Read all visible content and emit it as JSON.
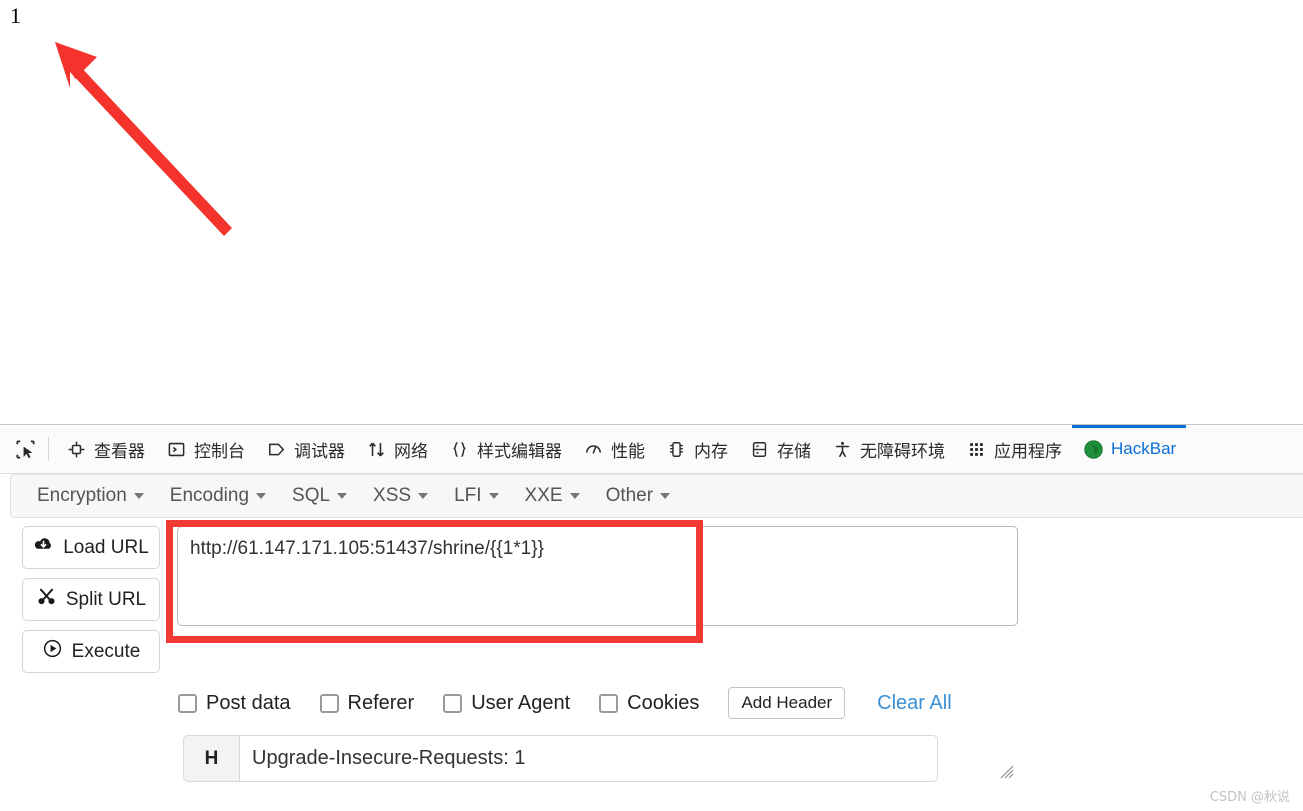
{
  "page": {
    "content_text": "1"
  },
  "devtools": {
    "picker_icon": "element-picker-icon",
    "tabs": [
      {
        "label": "查看器",
        "icon": "inspector-icon",
        "active": false
      },
      {
        "label": "控制台",
        "icon": "console-icon",
        "active": false
      },
      {
        "label": "调试器",
        "icon": "debugger-icon",
        "active": false
      },
      {
        "label": "网络",
        "icon": "network-icon",
        "active": false
      },
      {
        "label": "样式编辑器",
        "icon": "style-editor-icon",
        "active": false
      },
      {
        "label": "性能",
        "icon": "performance-icon",
        "active": false
      },
      {
        "label": "内存",
        "icon": "memory-icon",
        "active": false
      },
      {
        "label": "存储",
        "icon": "storage-icon",
        "active": false
      },
      {
        "label": "无障碍环境",
        "icon": "accessibility-icon",
        "active": false
      },
      {
        "label": "应用程序",
        "icon": "application-icon",
        "active": false
      },
      {
        "label": "HackBar",
        "icon": "hackbar-icon",
        "active": true
      }
    ],
    "active_tab_color": "#0b6fd6"
  },
  "hackbar": {
    "menus": [
      {
        "label": "Encryption"
      },
      {
        "label": "Encoding"
      },
      {
        "label": "SQL"
      },
      {
        "label": "XSS"
      },
      {
        "label": "LFI"
      },
      {
        "label": "XXE"
      },
      {
        "label": "Other"
      }
    ],
    "buttons": [
      {
        "label": "Load URL",
        "icon": "cloud-download-icon"
      },
      {
        "label": "Split URL",
        "icon": "scissors-icon"
      },
      {
        "label": "Execute",
        "icon": "play-circle-icon"
      }
    ],
    "url": {
      "value": "http://61.147.171.105:51437/shrine/{{1*1}}",
      "placeholder": ""
    },
    "checkboxes": [
      {
        "label": "Post data",
        "checked": false
      },
      {
        "label": "Referer",
        "checked": false
      },
      {
        "label": "User Agent",
        "checked": false
      },
      {
        "label": "Cookies",
        "checked": false
      }
    ],
    "add_header_label": "Add Header",
    "clear_all_label": "Clear All",
    "clear_all_color": "#3b8fd4",
    "headers": [
      {
        "key": "H",
        "value": "Upgrade-Insecure-Requests: 1"
      }
    ]
  },
  "annotations": {
    "arrow_color": "#f4332c",
    "rect_color": "#f03a33"
  },
  "watermark": {
    "text": "CSDN @秋说"
  }
}
